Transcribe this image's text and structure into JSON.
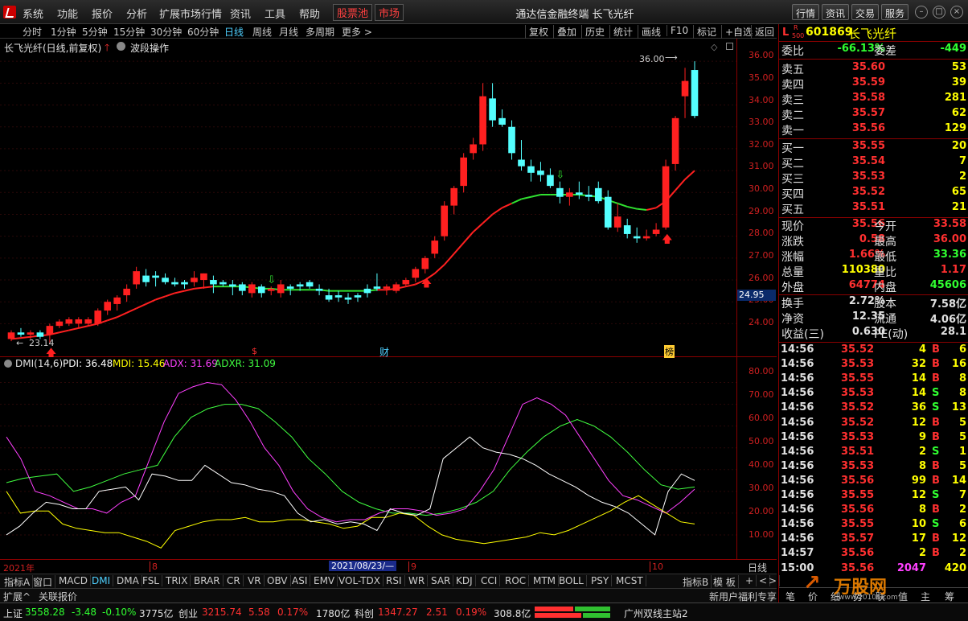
{
  "menubar": {
    "items": [
      "系统",
      "功能",
      "报价",
      "分析",
      "扩展市场行情",
      "资讯",
      "工具",
      "帮助"
    ],
    "highlight": [
      "股票池",
      "市场"
    ],
    "title": "通达信金融终端  长飞光纤",
    "right_buttons": [
      "行情",
      "资讯",
      "交易",
      "服务"
    ]
  },
  "periodbar": {
    "periods": [
      "分时",
      "1分钟",
      "5分钟",
      "15分钟",
      "30分钟",
      "60分钟",
      "日线",
      "周线",
      "月线",
      "多周期",
      "更多 >"
    ],
    "active": "日线",
    "tools": [
      "复权",
      "叠加",
      "历史",
      "统计",
      "画线",
      "F10",
      "标记",
      "+自选",
      "返回"
    ]
  },
  "chart_header": {
    "name": "长飞光纤(日线,前复权)",
    "indicator": "波段操作"
  },
  "main_axis": {
    "ticks": [
      "36.00",
      "35.00",
      "34.00",
      "33.00",
      "32.00",
      "31.00",
      "30.00",
      "29.00",
      "28.00",
      "27.00",
      "26.00",
      "25.00",
      "24.00"
    ],
    "current_price_label": "24.95"
  },
  "annotations": {
    "high_label": "36.00",
    "low_label": "23.14",
    "marker_s": "$",
    "marker_cai": "财",
    "marker_bang": "榜"
  },
  "dmi": {
    "title": "DMI(14,6)",
    "pdi_label": "PDI: 36.48",
    "mdi_label": "MDI: 15.46",
    "adx_label": "ADX: 31.69",
    "adxr_label": "ADXR: 31.09",
    "ticks": [
      "80.00",
      "70.00",
      "60.00",
      "50.00",
      "40.00",
      "30.00",
      "20.00",
      "10.00"
    ],
    "colors": {
      "pdi": "#ffffff",
      "mdi": "#ffff00",
      "adx": "#ff40ff",
      "adxr": "#40ff40"
    }
  },
  "datebar": {
    "year": "2021年",
    "m8": "8",
    "selected_date": "2021/08/23/—",
    "m9": "9",
    "m10": "10",
    "period": "日线"
  },
  "indicator_tabs": [
    "指标A",
    "窗口",
    "MACD",
    "DMI",
    "DMA",
    "FSL",
    "TRIX",
    "BRAR",
    "CR",
    "VR",
    "OBV",
    "ASI",
    "EMV",
    "VOL-TDX",
    "RSI",
    "WR",
    "SAR",
    "KDJ",
    "CCI",
    "ROC",
    "MTM",
    "BOLL",
    "PSY",
    "MCST"
  ],
  "indicator_tabs_active": "DMI",
  "indicator_right": [
    "指标B",
    "模 板",
    "+",
    "<",
    ">"
  ],
  "extbar": {
    "left": [
      "扩展^",
      "关联报价"
    ],
    "right": "新用户福利专享"
  },
  "side": {
    "header": {
      "code": "601869",
      "name": "长飞光纤",
      "badge_l": "L",
      "badge_r": "R",
      "badge_500": "500"
    },
    "weibi": {
      "label": "委比",
      "value": "-66.13%",
      "label2": "委差",
      "value2": "-449"
    },
    "sell": [
      {
        "label": "卖五",
        "price": "35.60",
        "vol": "53"
      },
      {
        "label": "卖四",
        "price": "35.59",
        "vol": "39"
      },
      {
        "label": "卖三",
        "price": "35.58",
        "vol": "281"
      },
      {
        "label": "卖二",
        "price": "35.57",
        "vol": "62"
      },
      {
        "label": "卖一",
        "price": "35.56",
        "vol": "129"
      }
    ],
    "buy": [
      {
        "label": "买一",
        "price": "35.55",
        "vol": "20"
      },
      {
        "label": "买二",
        "price": "35.54",
        "vol": "7"
      },
      {
        "label": "买三",
        "price": "35.53",
        "vol": "2"
      },
      {
        "label": "买四",
        "price": "35.52",
        "vol": "65"
      },
      {
        "label": "买五",
        "price": "35.51",
        "vol": "21"
      }
    ],
    "stats": [
      {
        "l1": "现价",
        "v1": "35.56",
        "l2": "今开",
        "v2": "33.58"
      },
      {
        "l1": "涨跌",
        "v1": "0.58",
        "l2": "最高",
        "v2": "36.00"
      },
      {
        "l1": "涨幅",
        "v1": "1.66%",
        "l2": "最低",
        "v2": "33.36"
      },
      {
        "l1": "总量",
        "v1": "110380",
        "l2": "量比",
        "v2": "1.17"
      },
      {
        "l1": "外盘",
        "v1": "64774",
        "l2": "内盘",
        "v2": "45606"
      }
    ],
    "stats2": [
      {
        "l1": "换手",
        "v1": "2.72%",
        "l2": "股本",
        "v2": "7.58亿"
      },
      {
        "l1": "净资",
        "v1": "12.35",
        "l2": "流通",
        "v2": "4.06亿"
      },
      {
        "l1": "收益(三)",
        "v1": "0.630",
        "l2": "PE(动)",
        "v2": "28.1"
      }
    ],
    "ticks": [
      {
        "t": "14:56",
        "p": "35.52",
        "v": "4",
        "d": "B",
        "n": "6"
      },
      {
        "t": "14:56",
        "p": "35.53",
        "v": "32",
        "d": "B",
        "n": "16"
      },
      {
        "t": "14:56",
        "p": "35.55",
        "v": "14",
        "d": "B",
        "n": "8"
      },
      {
        "t": "14:56",
        "p": "35.53",
        "v": "14",
        "d": "S",
        "n": "8"
      },
      {
        "t": "14:56",
        "p": "35.52",
        "v": "36",
        "d": "S",
        "n": "13"
      },
      {
        "t": "14:56",
        "p": "35.52",
        "v": "12",
        "d": "B",
        "n": "5"
      },
      {
        "t": "14:56",
        "p": "35.53",
        "v": "9",
        "d": "B",
        "n": "5"
      },
      {
        "t": "14:56",
        "p": "35.51",
        "v": "2",
        "d": "S",
        "n": "1"
      },
      {
        "t": "14:56",
        "p": "35.53",
        "v": "8",
        "d": "B",
        "n": "5"
      },
      {
        "t": "14:56",
        "p": "35.56",
        "v": "99",
        "d": "B",
        "n": "14"
      },
      {
        "t": "14:56",
        "p": "35.55",
        "v": "12",
        "d": "S",
        "n": "7"
      },
      {
        "t": "14:56",
        "p": "35.56",
        "v": "8",
        "d": "B",
        "n": "2"
      },
      {
        "t": "14:56",
        "p": "35.55",
        "v": "10",
        "d": "S",
        "n": "6"
      },
      {
        "t": "14:56",
        "p": "35.57",
        "v": "17",
        "d": "B",
        "n": "12"
      },
      {
        "t": "14:57",
        "p": "35.56",
        "v": "2",
        "d": "B",
        "n": "2"
      },
      {
        "t": "15:00",
        "p": "35.56",
        "v": "2047",
        "d": "",
        "n": "420"
      }
    ],
    "bottom_tabs": [
      "笔",
      "价",
      "细",
      "势",
      "联",
      "值",
      "主",
      "筹"
    ]
  },
  "statusbar": {
    "items": [
      {
        "name": "上证",
        "price": "3558.28",
        "chg": "-3.48",
        "pct": "-0.10%",
        "amt": "3775亿"
      },
      {
        "name": "创业",
        "price": "3215.74",
        "chg": "5.58",
        "pct": "0.17%",
        "amt": "1780亿"
      },
      {
        "name": "科创",
        "price": "1347.27",
        "chg": "2.51",
        "pct": "0.19%",
        "amt": "308.8亿"
      }
    ],
    "server": "广州双线主站2",
    "watermark": "万股网",
    "watermark_url": "www.2010s.com"
  },
  "chart_data": {
    "type": "candlestick",
    "ylim": [
      23.5,
      36.3
    ],
    "candles": [
      [
        23.3,
        23.7,
        23.2,
        23.6
      ],
      [
        23.6,
        23.8,
        23.4,
        23.5
      ],
      [
        23.5,
        23.7,
        23.3,
        23.6
      ],
      [
        23.6,
        23.7,
        23.3,
        23.4
      ],
      [
        23.5,
        24.0,
        23.1,
        23.9
      ],
      [
        23.9,
        24.2,
        23.8,
        24.1
      ],
      [
        24.0,
        24.3,
        23.9,
        24.2
      ],
      [
        24.0,
        24.3,
        23.8,
        24.2
      ],
      [
        24.0,
        24.3,
        23.9,
        24.2
      ],
      [
        24.0,
        24.7,
        23.9,
        24.6
      ],
      [
        24.6,
        25.1,
        24.4,
        25.0
      ],
      [
        24.9,
        25.3,
        24.6,
        25.2
      ],
      [
        25.3,
        25.8,
        25.0,
        25.6
      ],
      [
        25.8,
        26.6,
        25.6,
        26.4
      ],
      [
        26.2,
        26.5,
        25.7,
        25.9
      ],
      [
        26.2,
        26.4,
        25.7,
        26.1
      ],
      [
        26.1,
        26.3,
        25.8,
        25.9
      ],
      [
        25.9,
        26.1,
        25.7,
        25.8
      ],
      [
        25.9,
        26.0,
        25.6,
        25.8
      ],
      [
        25.9,
        26.4,
        25.7,
        26.1
      ],
      [
        26.0,
        26.3,
        25.6,
        26.3
      ],
      [
        26.0,
        26.2,
        25.4,
        25.8
      ],
      [
        25.9,
        26.0,
        25.7,
        25.8
      ],
      [
        25.8,
        26.0,
        25.3,
        25.7
      ],
      [
        25.8,
        25.9,
        25.3,
        25.5
      ],
      [
        25.4,
        25.9,
        25.2,
        25.8
      ],
      [
        25.7,
        25.8,
        25.2,
        25.4
      ],
      [
        25.5,
        25.7,
        25.3,
        25.6
      ],
      [
        25.4,
        26.0,
        25.2,
        25.8
      ],
      [
        25.7,
        25.8,
        25.3,
        25.6
      ],
      [
        25.8,
        25.9,
        25.5,
        25.7
      ],
      [
        25.9,
        26.0,
        25.6,
        25.7
      ],
      [
        25.6,
        25.8,
        25.3,
        25.5
      ],
      [
        25.3,
        25.6,
        25.0,
        25.1
      ],
      [
        25.3,
        25.5,
        25.0,
        25.2
      ],
      [
        25.2,
        25.4,
        24.9,
        25.1
      ],
      [
        25.3,
        25.4,
        25.0,
        25.2
      ],
      [
        25.6,
        25.8,
        25.2,
        25.4
      ],
      [
        25.7,
        26.3,
        25.5,
        25.6
      ],
      [
        25.6,
        25.8,
        25.3,
        25.7
      ],
      [
        25.5,
        25.9,
        25.4,
        25.8
      ],
      [
        25.8,
        26.1,
        25.7,
        26.0
      ],
      [
        26.1,
        26.6,
        25.9,
        26.5
      ],
      [
        26.5,
        27.1,
        26.3,
        27.0
      ],
      [
        27.2,
        28.0,
        27.0,
        27.8
      ],
      [
        28.0,
        29.6,
        27.8,
        29.4
      ],
      [
        29.4,
        30.3,
        29.0,
        30.2
      ],
      [
        30.3,
        31.8,
        30.0,
        31.6
      ],
      [
        31.8,
        32.5,
        31.5,
        32.2
      ],
      [
        32.2,
        35.0,
        31.9,
        34.4
      ],
      [
        34.3,
        35.0,
        33.0,
        33.3
      ],
      [
        33.4,
        33.8,
        33.0,
        33.1
      ],
      [
        33.0,
        33.3,
        31.5,
        31.8
      ],
      [
        31.5,
        32.4,
        31.0,
        31.2
      ],
      [
        31.2,
        31.5,
        30.5,
        30.9
      ],
      [
        31.0,
        31.4,
        30.5,
        30.8
      ],
      [
        30.8,
        31.1,
        30.2,
        30.3
      ],
      [
        30.2,
        30.5,
        29.5,
        29.8
      ],
      [
        29.8,
        30.2,
        29.4,
        30.0
      ],
      [
        30.0,
        30.5,
        29.7,
        29.9
      ],
      [
        29.9,
        30.3,
        29.6,
        29.8
      ],
      [
        30.2,
        30.5,
        29.5,
        29.6
      ],
      [
        29.8,
        30.1,
        28.3,
        28.4
      ],
      [
        28.4,
        29.5,
        28.2,
        28.9
      ],
      [
        28.5,
        28.8,
        27.9,
        28.1
      ],
      [
        28.0,
        28.4,
        27.7,
        27.9
      ],
      [
        27.9,
        28.3,
        27.8,
        28.0
      ],
      [
        28.1,
        28.6,
        28.0,
        28.3
      ],
      [
        28.4,
        31.5,
        28.3,
        31.2
      ],
      [
        31.3,
        33.5,
        31.0,
        33.4
      ],
      [
        34.4,
        35.7,
        33.4,
        35.1
      ],
      [
        35.6,
        36.0,
        33.4,
        33.5
      ]
    ],
    "ma": [
      23.3,
      23.35,
      23.4,
      23.45,
      23.5,
      23.6,
      23.7,
      23.8,
      23.9,
      24.0,
      24.15,
      24.3,
      24.5,
      24.7,
      24.9,
      25.1,
      25.25,
      25.4,
      25.5,
      25.6,
      25.65,
      25.7,
      25.7,
      25.7,
      25.7,
      25.65,
      25.6,
      25.6,
      25.55,
      25.55,
      25.55,
      25.55,
      25.55,
      25.5,
      25.5,
      25.5,
      25.5,
      25.5,
      25.55,
      25.55,
      25.6,
      25.7,
      25.8,
      26.0,
      26.3,
      26.7,
      27.2,
      27.7,
      28.2,
      28.6,
      29.0,
      29.3,
      29.5,
      29.7,
      29.8,
      29.9,
      29.9,
      29.9,
      29.9,
      29.9,
      29.85,
      29.8,
      29.65,
      29.5,
      29.35,
      29.25,
      29.2,
      29.3,
      29.6,
      30.1,
      30.6,
      31.0
    ],
    "ma_trend": [
      1,
      1,
      1,
      1,
      1,
      1,
      1,
      1,
      1,
      1,
      1,
      1,
      1,
      1,
      1,
      1,
      1,
      1,
      1,
      1,
      1,
      1,
      0,
      0,
      0,
      0,
      0,
      0,
      0,
      0,
      0,
      0,
      0,
      0,
      0,
      0,
      0,
      0,
      0,
      1,
      1,
      1,
      1,
      1,
      1,
      1,
      1,
      1,
      1,
      1,
      1,
      1,
      1,
      0,
      0,
      0,
      0,
      0,
      0,
      0,
      0,
      0,
      0,
      0,
      0,
      0,
      0,
      1,
      1,
      1,
      1,
      1
    ],
    "dmi_pdi": [
      10,
      14,
      20,
      25,
      24,
      22,
      22,
      30,
      31,
      32,
      26,
      38,
      37,
      35,
      35,
      42,
      38,
      34,
      33,
      31,
      30,
      28,
      20,
      16,
      17,
      15,
      16,
      15,
      12,
      22,
      20,
      19,
      22,
      45,
      50,
      55,
      50,
      48,
      47,
      45,
      42,
      38,
      35,
      32,
      28,
      25,
      23,
      20,
      15,
      10,
      30,
      38,
      35
    ],
    "dmi_mdi": [
      30,
      20,
      21,
      21,
      15,
      13,
      12,
      11,
      11,
      9,
      7,
      4,
      12,
      14,
      16,
      17,
      17,
      18,
      16,
      16,
      17,
      17,
      16,
      15,
      13,
      14,
      18,
      18,
      20,
      19,
      14,
      10,
      8,
      7,
      6,
      7,
      8,
      9,
      11,
      10,
      12,
      15,
      18,
      21,
      25,
      28,
      24,
      20,
      16,
      15
    ],
    "dmi_adx": [
      55,
      45,
      30,
      28,
      25,
      22,
      22,
      20,
      25,
      28,
      45,
      62,
      75,
      78,
      80,
      79,
      72,
      62,
      50,
      42,
      30,
      22,
      18,
      16,
      17,
      17,
      20,
      22,
      22,
      21,
      19,
      20,
      22,
      30,
      40,
      55,
      70,
      73,
      70,
      65,
      55,
      45,
      35,
      28,
      26,
      23,
      20,
      25,
      31
    ],
    "dmi_adxr": [
      34,
      36,
      37,
      38,
      30,
      32,
      35,
      38,
      40,
      42,
      55,
      64,
      68,
      70,
      70,
      68,
      62,
      55,
      45,
      38,
      30,
      25,
      22,
      20,
      20,
      19,
      20,
      22,
      25,
      30,
      40,
      48,
      55,
      60,
      63,
      60,
      55,
      48,
      40,
      33,
      31,
      32
    ]
  }
}
